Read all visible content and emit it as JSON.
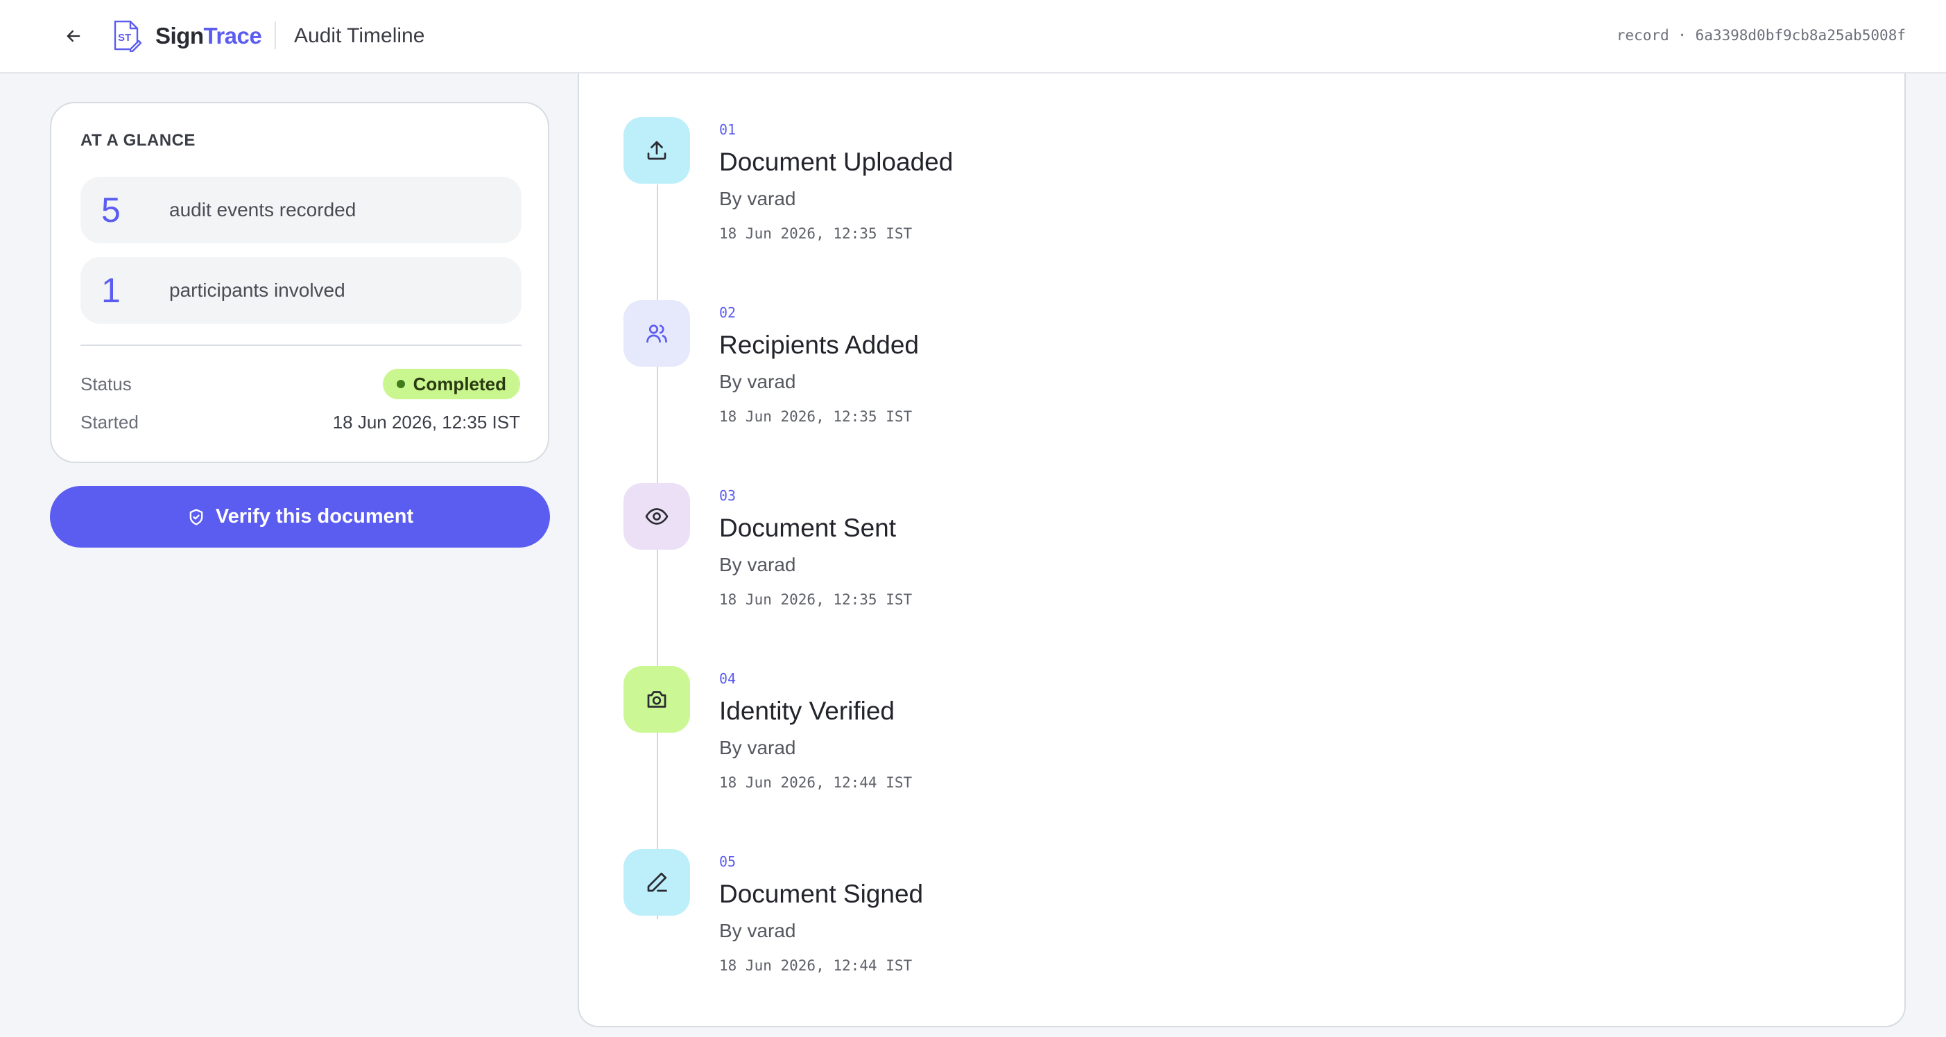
{
  "header": {
    "brand_part1": "Sign",
    "brand_part2": "Trace",
    "title": "Audit Timeline",
    "record_id": "record · 6a3398d0bf9cb8a25ab5008f"
  },
  "glance": {
    "heading": "AT A GLANCE",
    "stats": [
      {
        "value": "5",
        "label": "audit events recorded"
      },
      {
        "value": "1",
        "label": "participants involved"
      }
    ],
    "status_label": "Status",
    "status_value": "Completed",
    "started_label": "Started",
    "started_value": "18 Jun 2026, 12:35 IST"
  },
  "verify_button": {
    "label": "Verify this document"
  },
  "events": [
    {
      "num": "01",
      "title": "Document Uploaded",
      "by": "By varad",
      "time": "18 Jun 2026, 12:35 IST",
      "icon": "upload-icon",
      "color": "#bdeffb"
    },
    {
      "num": "02",
      "title": "Recipients Added",
      "by": "By varad",
      "time": "18 Jun 2026, 12:35 IST",
      "icon": "users-icon",
      "color": "#e6e8fb"
    },
    {
      "num": "03",
      "title": "Document Sent",
      "by": "By varad",
      "time": "18 Jun 2026, 12:35 IST",
      "icon": "eye-icon",
      "color": "#ece0f6"
    },
    {
      "num": "04",
      "title": "Identity Verified",
      "by": "By varad",
      "time": "18 Jun 2026, 12:44 IST",
      "icon": "camera-icon",
      "color": "#cbf894"
    },
    {
      "num": "05",
      "title": "Document Signed",
      "by": "By varad",
      "time": "18 Jun 2026, 12:44 IST",
      "icon": "pen-icon",
      "color": "#bdeffb"
    }
  ],
  "colors": {
    "accent": "#5b5cf0",
    "status_badge": "#c9f68e"
  }
}
